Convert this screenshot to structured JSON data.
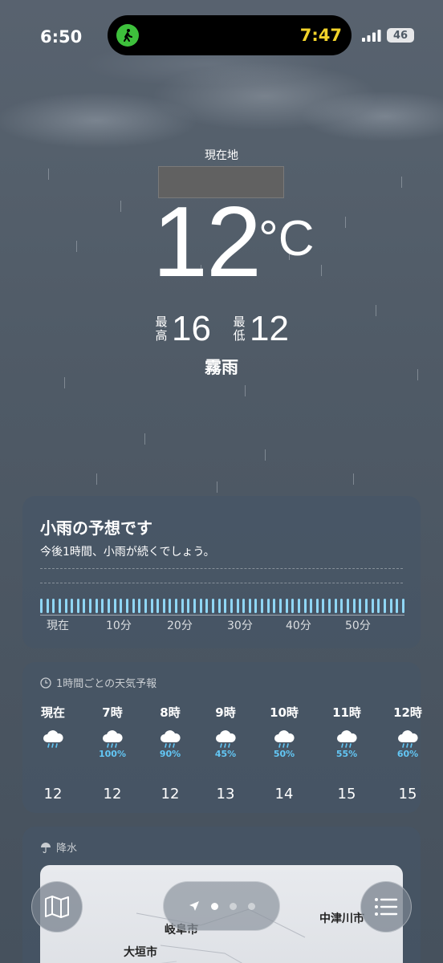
{
  "status_bar": {
    "time": "6:50",
    "island_time": "7:47",
    "battery": "46"
  },
  "current": {
    "location_label": "現在地",
    "temperature": "12",
    "unit": "°C",
    "high_label": "最高",
    "high": "16",
    "low_label": "最低",
    "low": "12",
    "condition": "霧雨"
  },
  "precip_card": {
    "title": "小雨の予想です",
    "subtitle": "今後1時間、小雨が続くでしょう。",
    "axis_labels": [
      "現在",
      "10分",
      "20分",
      "30分",
      "40分",
      "50分"
    ]
  },
  "hourly_card": {
    "header": "1時間ごとの天気予報",
    "hours": [
      {
        "time": "現在",
        "icon": "rain-cloud-icon",
        "chance": "",
        "temp": "12"
      },
      {
        "time": "7時",
        "icon": "rain-cloud-icon",
        "chance": "100%",
        "temp": "12"
      },
      {
        "time": "8時",
        "icon": "rain-cloud-icon",
        "chance": "90%",
        "temp": "12"
      },
      {
        "time": "9時",
        "icon": "rain-cloud-icon",
        "chance": "45%",
        "temp": "13"
      },
      {
        "time": "10時",
        "icon": "rain-cloud-icon",
        "chance": "50%",
        "temp": "14"
      },
      {
        "time": "11時",
        "icon": "rain-cloud-icon",
        "chance": "55%",
        "temp": "15"
      },
      {
        "time": "12時",
        "icon": "rain-cloud-icon",
        "chance": "60%",
        "temp": "15"
      }
    ]
  },
  "precip_map_card": {
    "header": "降水",
    "labels": [
      "岐阜市",
      "大垣市",
      "中津川市"
    ]
  },
  "colors": {
    "accent_rain": "#63c7f5",
    "bar_fill": "#8fd6f4",
    "island_time": "#f1d22a",
    "walk_icon_bg": "#3ec03c"
  }
}
